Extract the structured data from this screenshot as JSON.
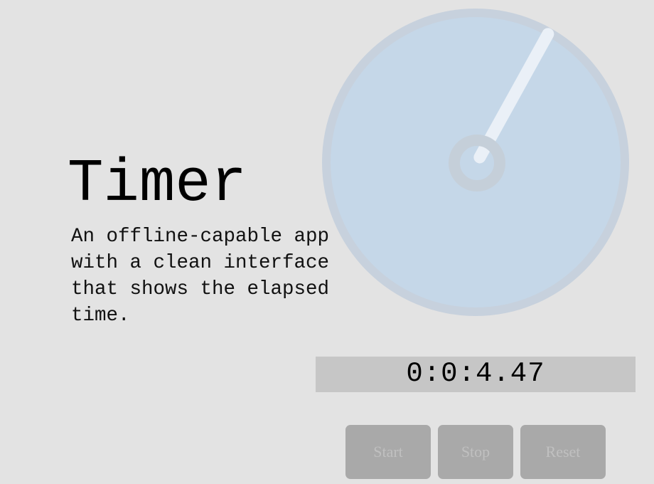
{
  "app": {
    "title": "Timer",
    "description": "An offline-capable app with a clean interface that shows the elapsed time."
  },
  "clock": {
    "hand_angle_deg": 29
  },
  "display": {
    "elapsed": "0:0:4.47"
  },
  "controls": {
    "start_label": "Start",
    "stop_label": "Stop",
    "reset_label": "Reset",
    "start_enabled": false,
    "stop_enabled": false,
    "reset_enabled": false
  },
  "colors": {
    "background": "#e3e3e3",
    "dial_face": "#c5d7e8",
    "dial_rim": "#c7d1dd",
    "hand": "#eaf0f7",
    "hub": "#c5cfd9",
    "readout_bg": "#c6c6c6",
    "button_bg": "#a9a9a9",
    "button_text": "#c0c0c0"
  }
}
